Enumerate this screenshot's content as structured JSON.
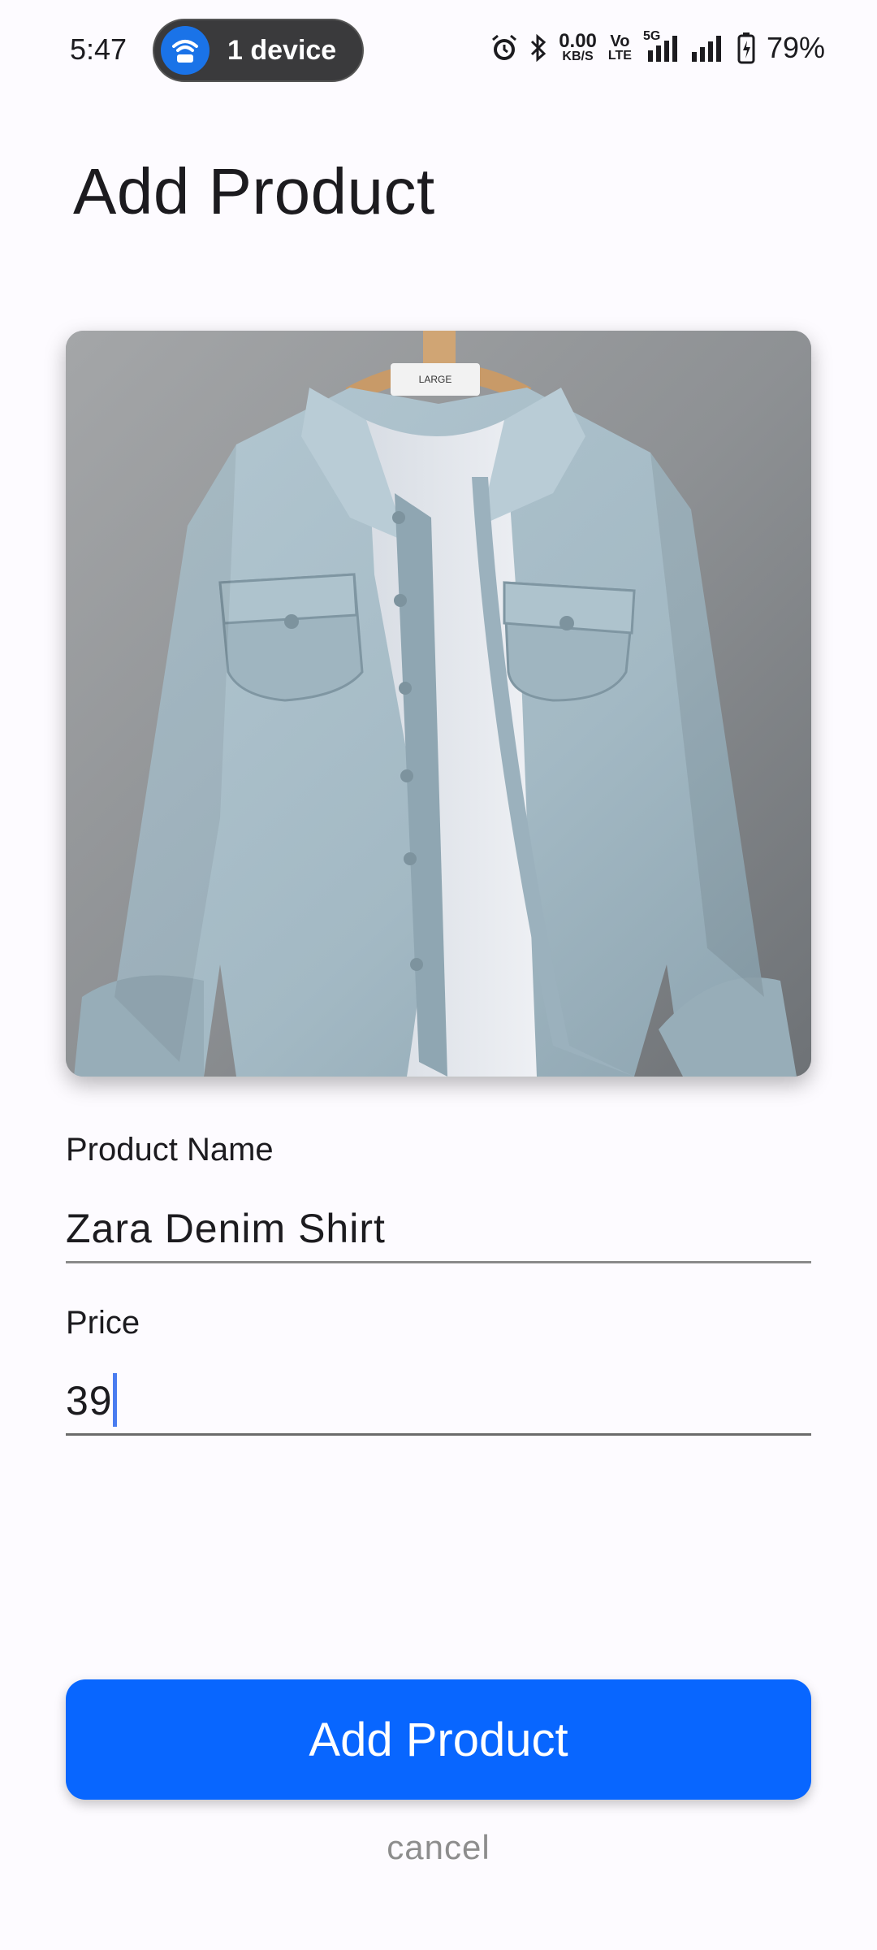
{
  "status_bar": {
    "time": "5:47",
    "hotspot_label": "1 device",
    "net_speed_value": "0.00",
    "net_speed_unit": "KB/S",
    "volte_top": "Vo",
    "volte_bottom": "LTE",
    "network_type": "5G",
    "battery_percent": "79%"
  },
  "page": {
    "title": "Add Product"
  },
  "product_image": {
    "subject": "light blue denim shirt on hanger",
    "tag_text": "LARGE"
  },
  "form": {
    "name_label": "Product Name",
    "name_value": "Zara Denim Shirt",
    "price_label": "Price",
    "price_value": "39"
  },
  "actions": {
    "submit_label": "Add Product",
    "cancel_label": "cancel"
  },
  "colors": {
    "primary": "#0866ff",
    "caret": "#4a7cf0",
    "cancel_text": "#8d8d8d"
  }
}
